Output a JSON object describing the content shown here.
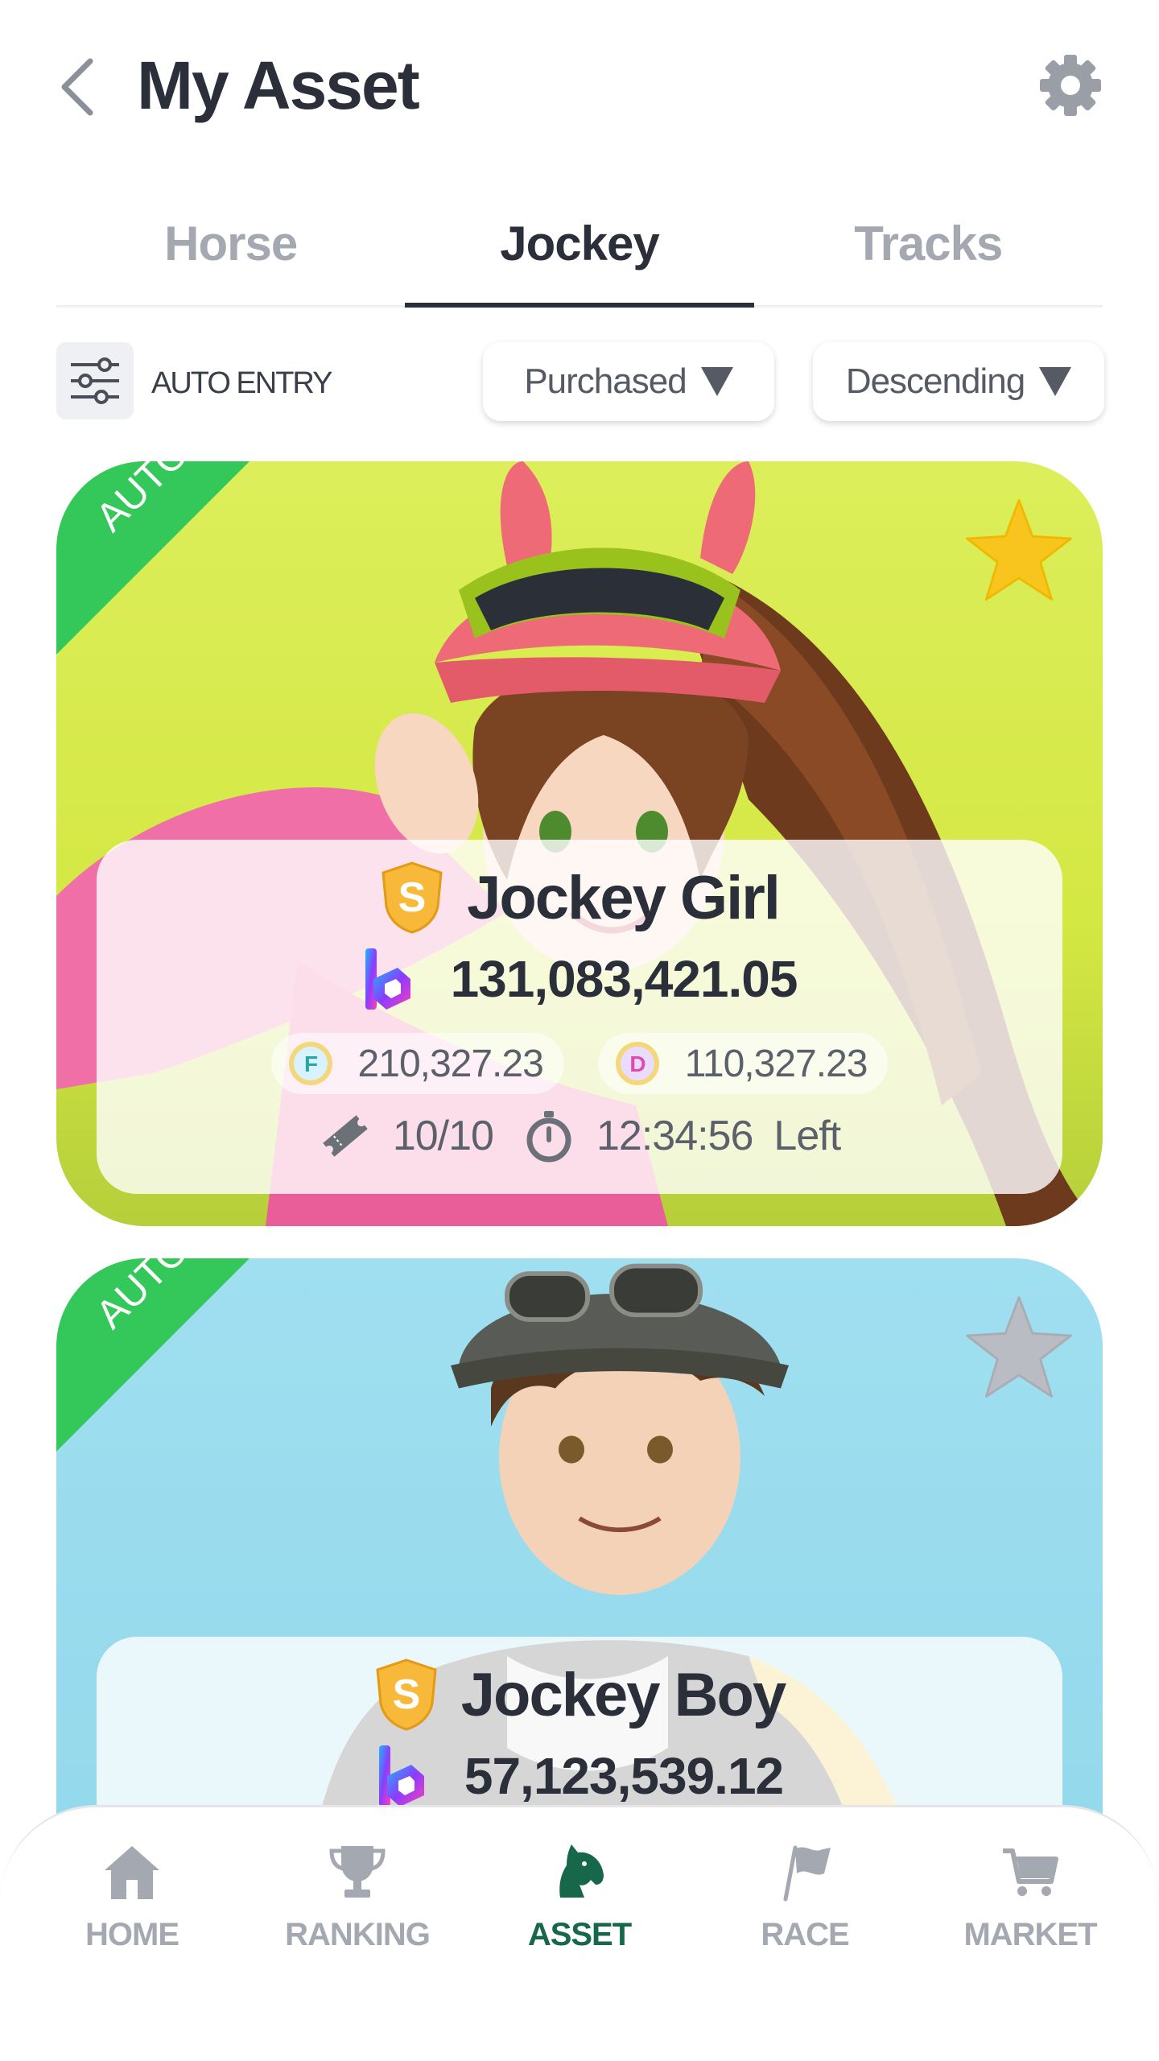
{
  "header": {
    "title": "My Asset"
  },
  "tabs": [
    {
      "label": "Horse",
      "active": false
    },
    {
      "label": "Jockey",
      "active": true
    },
    {
      "label": "Tracks",
      "active": false
    }
  ],
  "filters": {
    "auto_entry_label": "AUTO ENTRY",
    "sort_by": "Purchased",
    "order": "Descending"
  },
  "jockeys": [
    {
      "ribbon": "AUTO",
      "grade": "S",
      "name": "Jockey Girl",
      "price": "131,083,421.05",
      "token_f_letter": "F",
      "token_f": "210,327.23",
      "token_d_letter": "D",
      "token_d": "110,327.23",
      "tickets": "10/10",
      "time_left": "12:34:56",
      "time_suffix": "Left",
      "favorite": true,
      "bg_color": "#d4e843"
    },
    {
      "ribbon": "AUTO",
      "grade": "S",
      "name": "Jockey Boy",
      "price": "57,123,539.12",
      "favorite": false,
      "bg_color": "#90d6ea"
    }
  ],
  "nav": [
    {
      "label": "HOME",
      "icon": "home-icon",
      "active": false
    },
    {
      "label": "RANKING",
      "icon": "trophy-icon",
      "active": false
    },
    {
      "label": "ASSET",
      "icon": "horse-head-icon",
      "active": true
    },
    {
      "label": "RACE",
      "icon": "flag-icon",
      "active": false
    },
    {
      "label": "MARKET",
      "icon": "cart-icon",
      "active": false
    }
  ],
  "colors": {
    "accent": "#17684a",
    "text_dark": "#2b2f3a",
    "text_muted": "#a4a8b0",
    "ribbon_green": "#34c759",
    "star_gold": "#f7c51e",
    "star_grey": "#b9bcc2"
  }
}
